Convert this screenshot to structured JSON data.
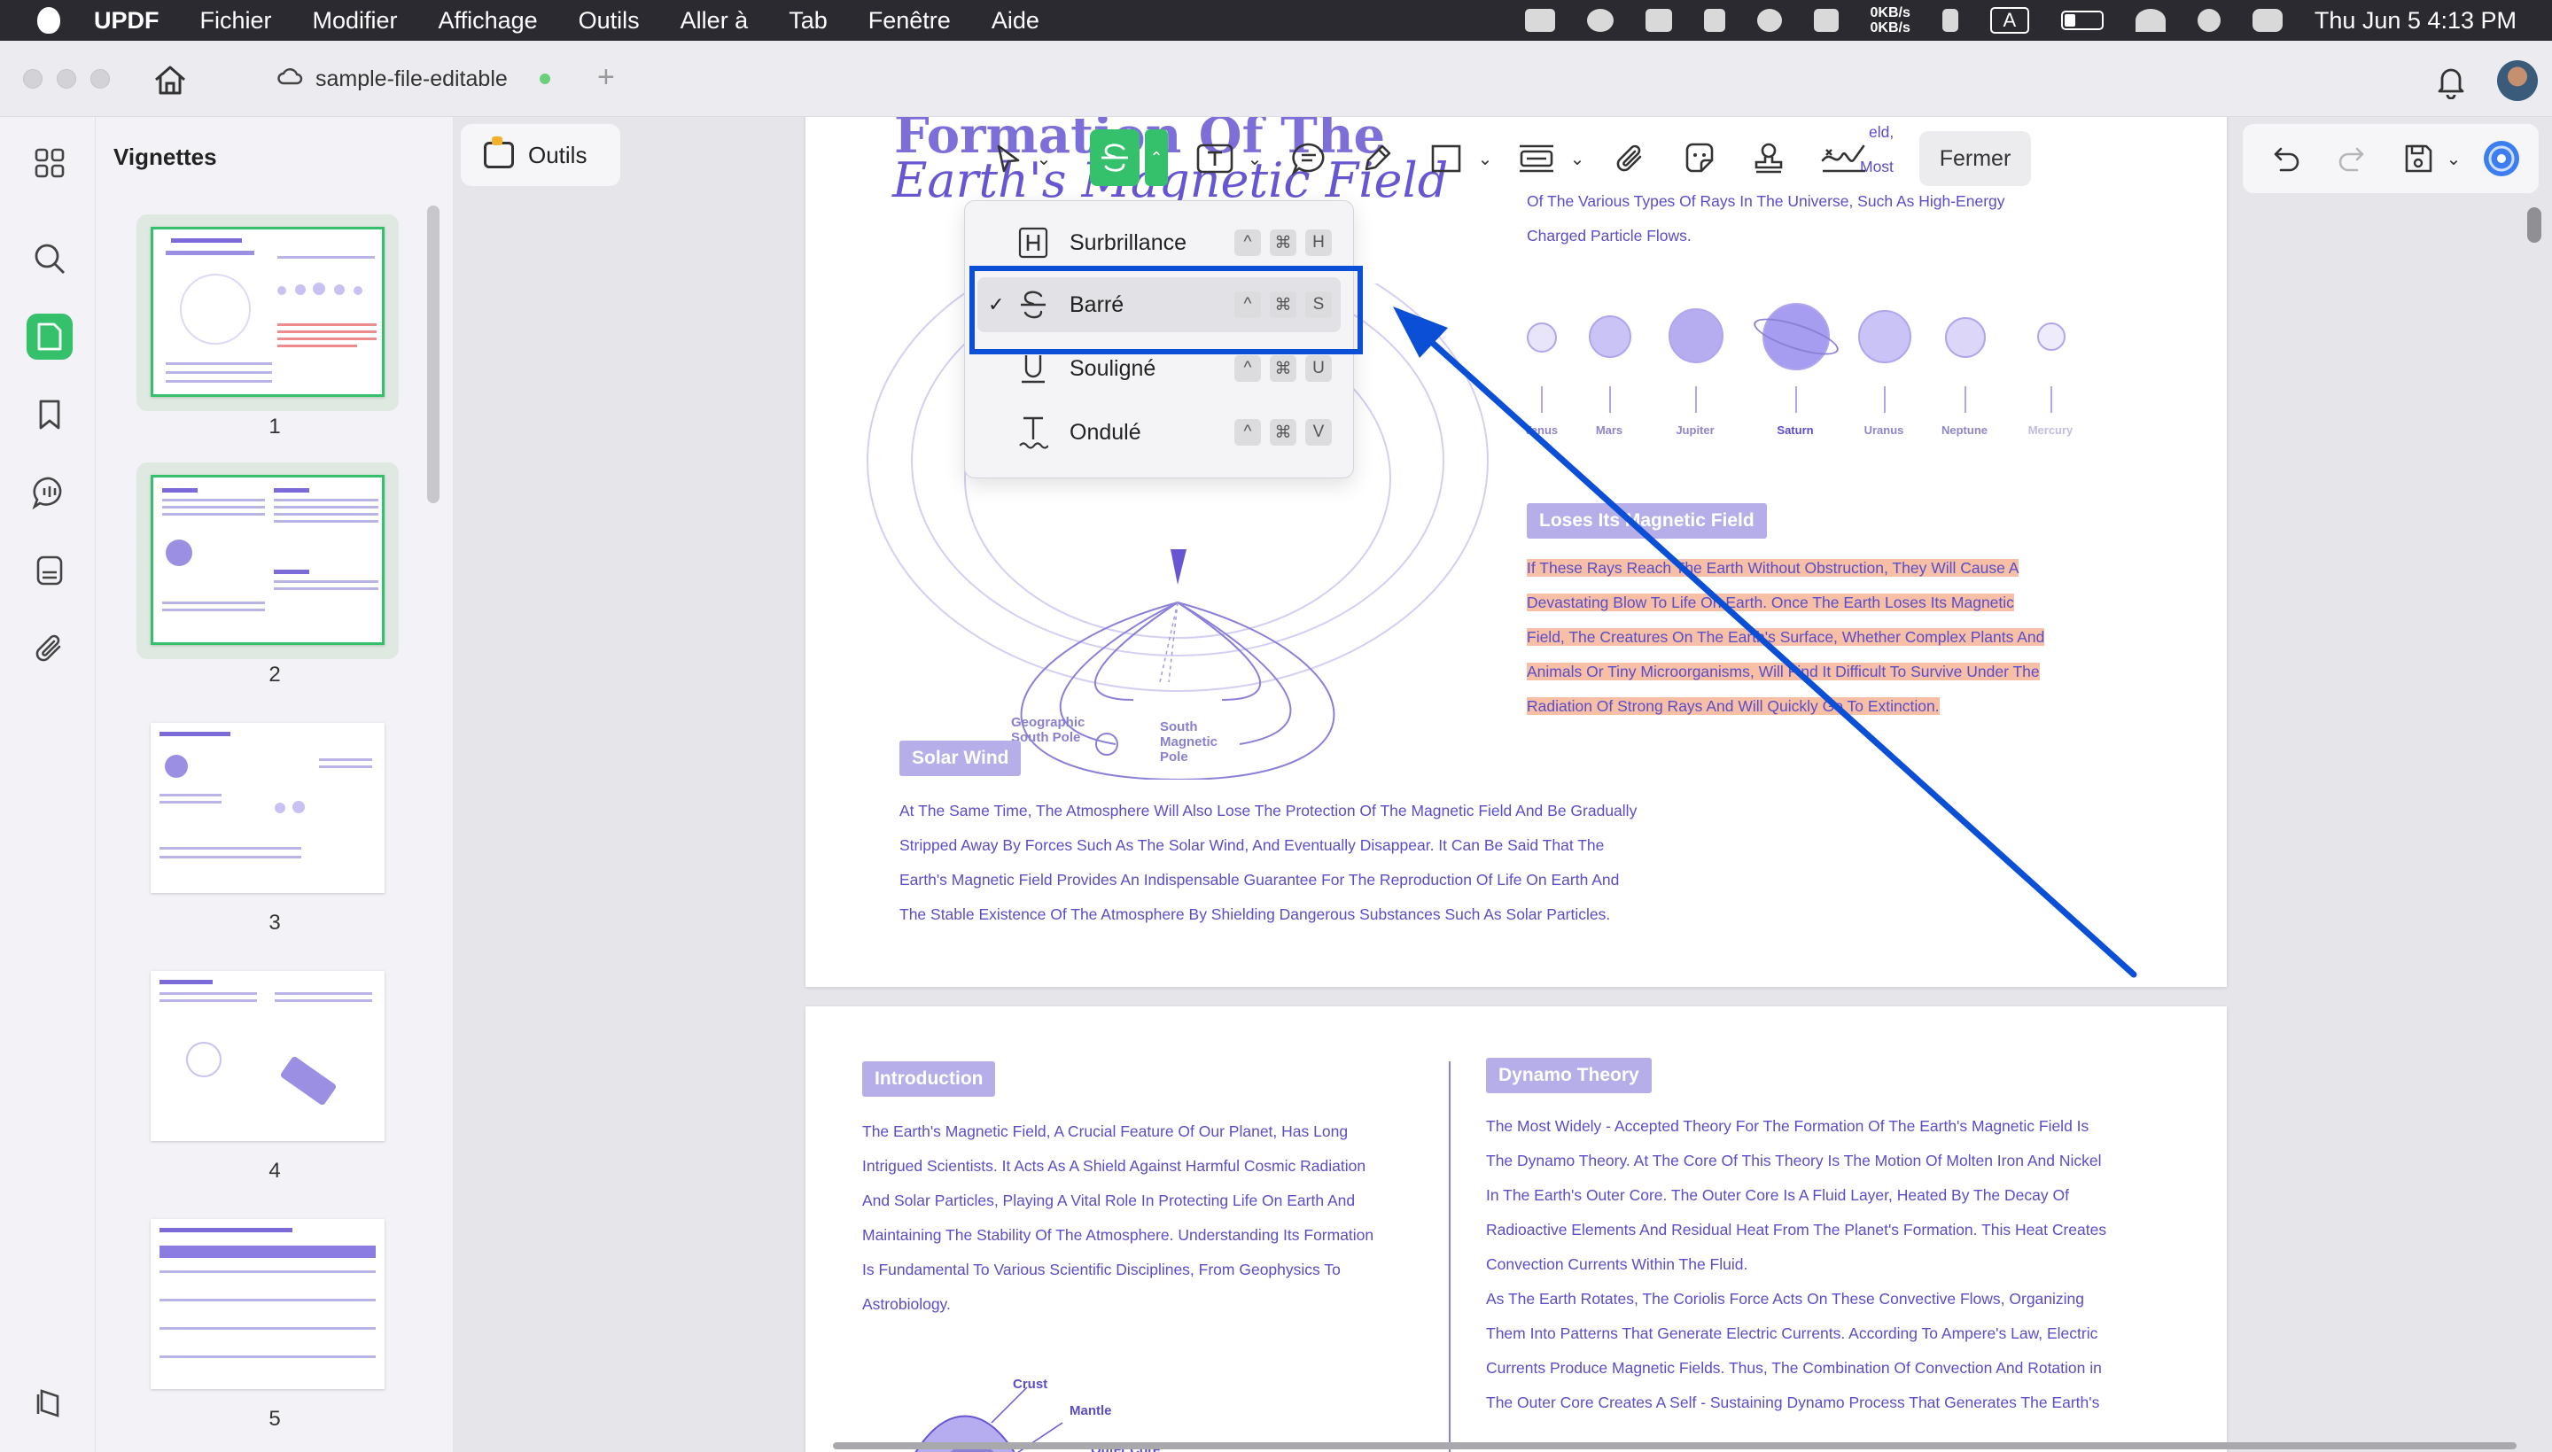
{
  "menubar": {
    "app_name": "UPDF",
    "items": [
      "Fichier",
      "Modifier",
      "Affichage",
      "Outils",
      "Aller à",
      "Tab",
      "Fenêtre",
      "Aide"
    ],
    "net_up": "0KB/s",
    "net_down": "0KB/s",
    "input_source": "A",
    "datetime": "Thu Jun 5  4:13 PM"
  },
  "tabbar": {
    "doc_tab_title": "sample-file-editable",
    "new_tab_label": "+"
  },
  "thumbnails": {
    "title": "Vignettes",
    "pages": [
      "1",
      "2",
      "3",
      "4",
      "5"
    ],
    "selected": [
      "1",
      "2"
    ]
  },
  "tools_button": {
    "label": "Outils"
  },
  "annotation_toolbar": {
    "close_label": "Fermer",
    "active_tool": "strikethrough"
  },
  "markup_menu": {
    "items": [
      {
        "label": "Surbrillance",
        "icon": "highlight-icon",
        "keys": [
          "^",
          "⌘",
          "H"
        ],
        "checked": false
      },
      {
        "label": "Barré",
        "icon": "strikethrough-icon",
        "keys": [
          "^",
          "⌘",
          "S"
        ],
        "checked": true
      },
      {
        "label": "Souligné",
        "icon": "underline-icon",
        "keys": [
          "^",
          "⌘",
          "U"
        ],
        "checked": false
      },
      {
        "label": "Ondulé",
        "icon": "squiggly-icon",
        "keys": [
          "^",
          "⌘",
          "V"
        ],
        "checked": false
      }
    ],
    "check_mark": "✓"
  },
  "page1": {
    "title_line1": "Formation Of The",
    "title_line2": "Earth's Magnetic Field",
    "top_right_frag1": "eld,",
    "top_right_frag2": "Most",
    "rays_line1": "Of The Various Types Of Rays In The Universe, Such As High-Energy",
    "rays_line2": "Charged Particle Flows.",
    "planets": [
      "Venus",
      "Mars",
      "Jupiter",
      "Saturn",
      "Uranus",
      "Neptune",
      "Mercury"
    ],
    "geo_south_pole": "Geographic\nSouth Pole",
    "mag_south_pole": "South\nMagnetic\nPole",
    "loses_tag": "Loses Its Magnetic Field",
    "loses_text": [
      "If These Rays Reach The Earth Without Obstruction, They Will Cause A",
      "Devastating Blow To Life On Earth. Once The Earth Loses Its Magnetic",
      "Field, The Creatures On The Earth's Surface, Whether Complex Plants And",
      "Animals Or Tiny Microorganisms, Will Find It Difficult To Survive Under The",
      "Radiation Of Strong Rays And Will Quickly Go To Extinction."
    ],
    "solar_tag": "Solar Wind",
    "solar_text": [
      "At The Same Time, The Atmosphere Will Also Lose The Protection Of The Magnetic Field And Be Gradually",
      "Stripped Away By Forces Such As The Solar Wind, And Eventually Disappear. It Can Be Said That The",
      "Earth's Magnetic Field Provides An Indispensable Guarantee For The Reproduction Of Life On Earth And",
      "The Stable Existence Of The Atmosphere By Shielding Dangerous Substances Such As Solar Particles."
    ]
  },
  "page2": {
    "intro_tag": "Introduction",
    "intro_text": [
      "The Earth's Magnetic Field, A Crucial Feature Of Our Planet, Has Long",
      "Intrigued Scientists. It Acts As A Shield Against Harmful Cosmic Radiation",
      "And Solar Particles, Playing A Vital Role In Protecting Life On Earth And",
      "Maintaining The Stability Of The Atmosphere. Understanding Its Formation",
      "Is Fundamental To Various Scientific Disciplines, From Geophysics To",
      "Astrobiology."
    ],
    "crust_label": "Crust",
    "mantle_label": "Mantle",
    "outer_core_label": "Outer Core",
    "dynamo_tag": "Dynamo Theory",
    "dynamo_text": [
      "The Most Widely - Accepted Theory For The Formation Of The Earth's Magnetic Field Is",
      "The Dynamo Theory. At The Core Of This Theory Is The Motion Of Molten Iron And Nickel",
      "In The Earth's Outer Core. The Outer Core Is A Fluid Layer, Heated By The Decay Of",
      "Radioactive Elements And Residual Heat From The Planet's Formation. This Heat Creates",
      "Convection Currents Within The Fluid.",
      "As The Earth Rotates, The Coriolis Force Acts On These Convective Flows, Organizing",
      "Them Into Patterns That Generate Electric Currents. According To Ampere's Law, Electric",
      "Currents Produce Magnetic Fields. Thus, The Combination Of Convection And Rotation in",
      "The Outer Core Creates A Self - Sustaining Dynamo Process That Generates The Earth's"
    ]
  },
  "colors": {
    "accent_green": "#35c06b",
    "focus_blue": "#0b4fd6",
    "doc_purple": "#5a4dc9",
    "highlight_salmon": "#f6bfa6"
  }
}
